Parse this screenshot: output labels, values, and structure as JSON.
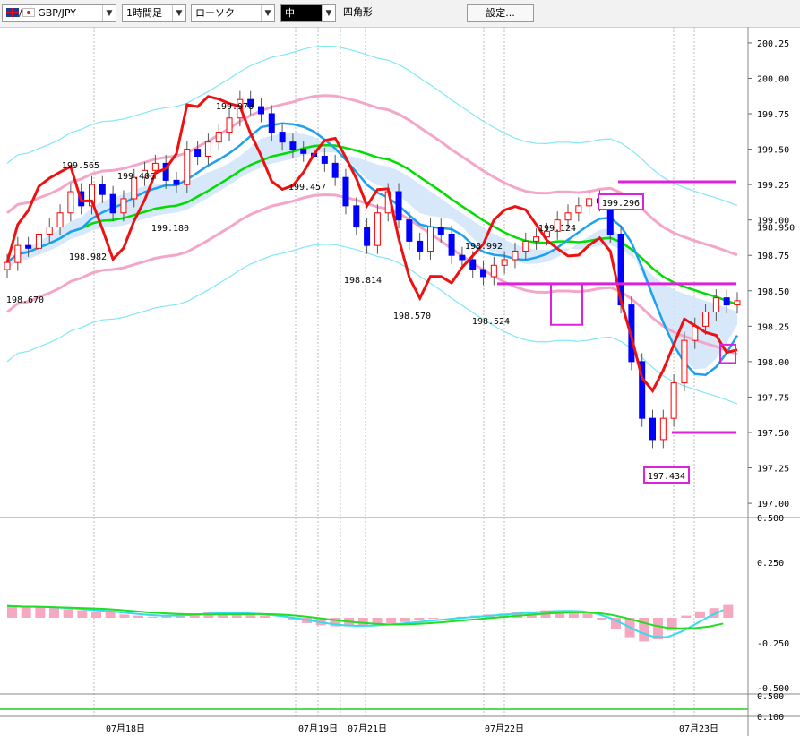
{
  "toolbar": {
    "pair_label": "GBP/JPY",
    "timeframe": "1時間足",
    "chart_style": "ローソク",
    "line_weight_label": "中",
    "drawing_tool": "四角形",
    "settings_button": "設定..."
  },
  "chart_data": {
    "type": "candlestick",
    "symbol": "GBP/JPY",
    "timeframe": "1時間足",
    "price_axis": {
      "ylim": [
        196.95,
        200.3
      ],
      "ticks": [
        "200.25",
        "200.00",
        "199.75",
        "199.50",
        "199.25",
        "199.00",
        "198.75",
        "198.50",
        "198.25",
        "198.00",
        "197.75",
        "197.50",
        "197.25",
        "197.00"
      ],
      "current_price": "198.950"
    },
    "x_ticks": [
      "07月18日",
      "07月19日",
      "07月21日",
      "07月22日",
      "07月23日"
    ],
    "price_annotations": [
      "199.978",
      "199.565",
      "199.406",
      "199.180",
      "198.982",
      "198.670",
      "199.457",
      "198.814",
      "198.570",
      "198.992",
      "198.524",
      "199.124",
      "199.296",
      "197.434"
    ],
    "horizontal_lines": [
      199.27,
      198.55,
      197.5
    ],
    "indicators": [
      "Bollinger Bands",
      "Ichimoku Cloud",
      "Moving Averages",
      "RCI",
      "MACD"
    ],
    "colors": {
      "up_candle": "#ff0000",
      "down_candle": "#0000ff",
      "ma_green": "#00dd00",
      "ma_blue": "#1ea0f0",
      "band_pink": "#f4a6c8",
      "band_cyan": "#7fe7f7",
      "osc_red": "#ee1111",
      "cloud": "#cfe4f8",
      "cloud_pink": "#f6c8dc",
      "box_magenta": "#dd22dd"
    },
    "closes": [
      198.7,
      198.82,
      198.8,
      198.9,
      198.95,
      199.05,
      199.2,
      199.1,
      199.25,
      199.18,
      199.05,
      199.15,
      199.3,
      199.35,
      199.4,
      199.28,
      199.25,
      199.5,
      199.45,
      199.55,
      199.62,
      199.72,
      199.85,
      199.8,
      199.75,
      199.62,
      199.55,
      199.5,
      199.47,
      199.45,
      199.4,
      199.3,
      199.1,
      198.95,
      198.82,
      199.05,
      199.2,
      199.0,
      198.85,
      198.78,
      198.95,
      198.9,
      198.75,
      198.72,
      198.65,
      198.6,
      198.68,
      198.72,
      198.78,
      198.85,
      198.88,
      198.92,
      199.0,
      199.05,
      199.1,
      199.15,
      199.12,
      198.9,
      198.4,
      198.0,
      197.6,
      197.45,
      197.6,
      197.85,
      198.15,
      198.25,
      198.35,
      198.45,
      198.4,
      198.43
    ],
    "macd_bars": [
      0.11,
      0.1,
      0.1,
      0.09,
      0.08,
      0.07,
      0.06,
      0.05,
      0.03,
      0.02,
      0.01,
      0.02,
      0.03,
      0.04,
      0.05,
      0.05,
      0.04,
      0.03,
      0.02,
      0.0,
      -0.02,
      -0.05,
      -0.07,
      -0.08,
      -0.08,
      -0.07,
      -0.06,
      -0.05,
      -0.04,
      -0.02,
      -0.01,
      0.0,
      0.01,
      0.02,
      0.03,
      0.04,
      0.05,
      0.06,
      0.07,
      0.07,
      0.06,
      0.04,
      -0.02,
      -0.1,
      -0.18,
      -0.22,
      -0.2,
      -0.12,
      0.02,
      0.06,
      0.09,
      0.12
    ],
    "macd_axis": [
      "0.500",
      "0.250",
      "-0.250",
      "-0.500"
    ],
    "bottom_axis": [
      "0.500",
      "0.100"
    ]
  }
}
